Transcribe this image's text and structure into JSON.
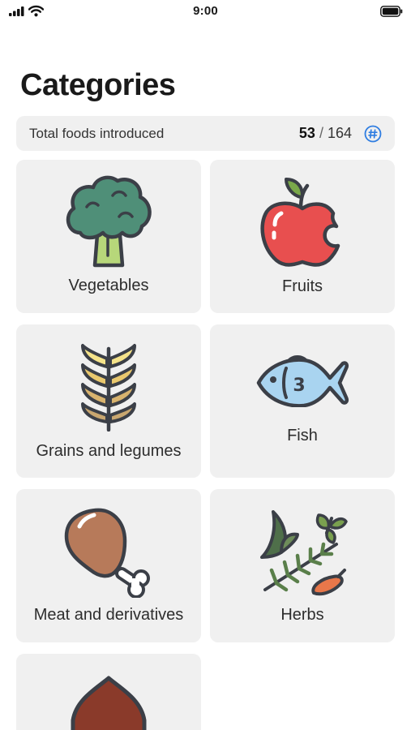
{
  "status_bar": {
    "time": "9:00"
  },
  "page": {
    "title": "Categories"
  },
  "summary": {
    "label": "Total foods introduced",
    "introduced": "53",
    "separator": "/",
    "total": "164",
    "icon": "hashtag-circle-icon"
  },
  "categories": [
    {
      "label": "Vegetables",
      "icon": "broccoli-icon"
    },
    {
      "label": "Fruits",
      "icon": "apple-icon"
    },
    {
      "label": "Grains and legumes",
      "icon": "wheat-icon"
    },
    {
      "label": "Fish",
      "icon": "fish-icon"
    },
    {
      "label": "Meat and derivatives",
      "icon": "chicken-leg-icon"
    },
    {
      "label": "Herbs",
      "icon": "herbs-icon"
    },
    {
      "label": "",
      "icon": "chestnut-icon"
    }
  ],
  "colors": {
    "accent": "#2f7de1",
    "card_background": "#f0f0f0",
    "outline": "#3b3f47"
  }
}
